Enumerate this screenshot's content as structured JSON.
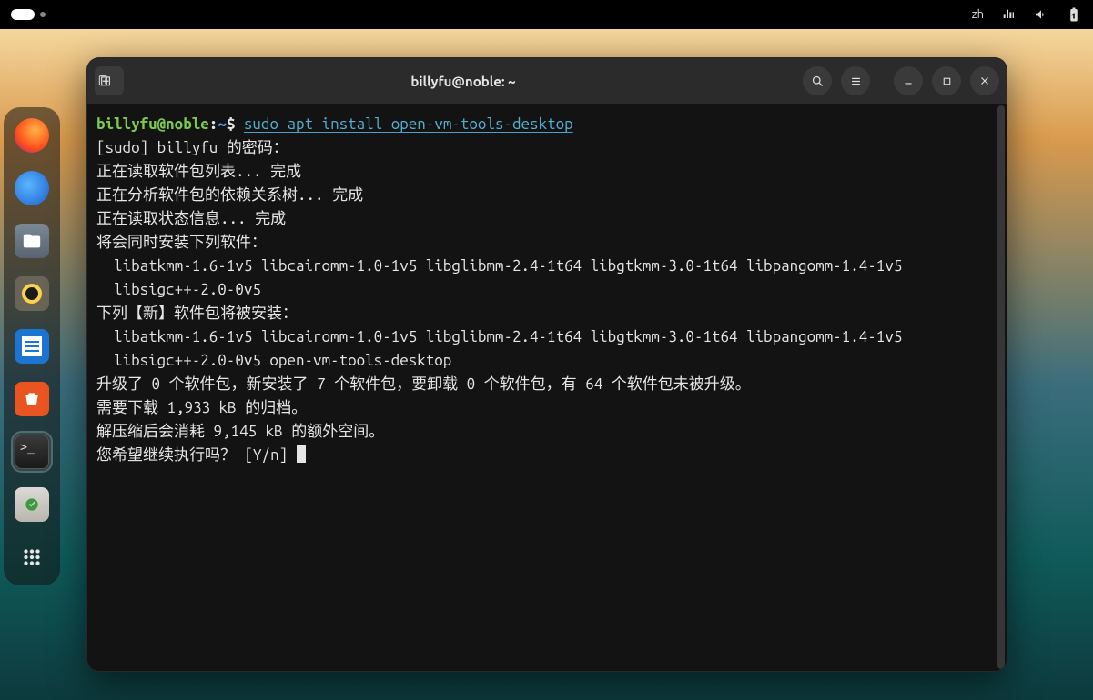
{
  "topbar": {
    "lang": "zh"
  },
  "dock": {
    "items": [
      {
        "name": "firefox",
        "active": false
      },
      {
        "name": "thunderbird",
        "active": false
      },
      {
        "name": "files",
        "active": false
      },
      {
        "name": "rhythmbox",
        "active": false
      },
      {
        "name": "writer",
        "active": false
      },
      {
        "name": "software",
        "active": false
      },
      {
        "name": "terminal",
        "active": true
      },
      {
        "name": "trash",
        "active": false
      },
      {
        "name": "show-apps",
        "active": false
      }
    ]
  },
  "window": {
    "title": "billyfu@noble: ~"
  },
  "prompt": {
    "user": "billyfu@noble",
    "sep": ":",
    "path": "~",
    "dollar": "$",
    "command": "sudo apt install open-vm-tools-desktop"
  },
  "lines": {
    "l1": "[sudo] billyfu 的密码：",
    "l2": "正在读取软件包列表... 完成",
    "l3": "正在分析软件包的依赖关系树... 完成",
    "l4": "正在读取状态信息... 完成",
    "l5": "将会同时安装下列软件：",
    "l6": "  libatkmm-1.6-1v5 libcairomm-1.0-1v5 libglibmm-2.4-1t64 libgtkmm-3.0-1t64 libpangomm-1.4-1v5",
    "l7": "  libsigc++-2.0-0v5",
    "l8": "下列【新】软件包将被安装：",
    "l9": "  libatkmm-1.6-1v5 libcairomm-1.0-1v5 libglibmm-2.4-1t64 libgtkmm-3.0-1t64 libpangomm-1.4-1v5",
    "l10": "  libsigc++-2.0-0v5 open-vm-tools-desktop",
    "l11": "升级了 0 个软件包，新安装了 7 个软件包，要卸载 0 个软件包，有 64 个软件包未被升级。",
    "l12": "需要下载 1,933 kB 的归档。",
    "l13": "解压缩后会消耗 9,145 kB 的额外空间。",
    "l14": "您希望继续执行吗？ [Y/n] "
  }
}
